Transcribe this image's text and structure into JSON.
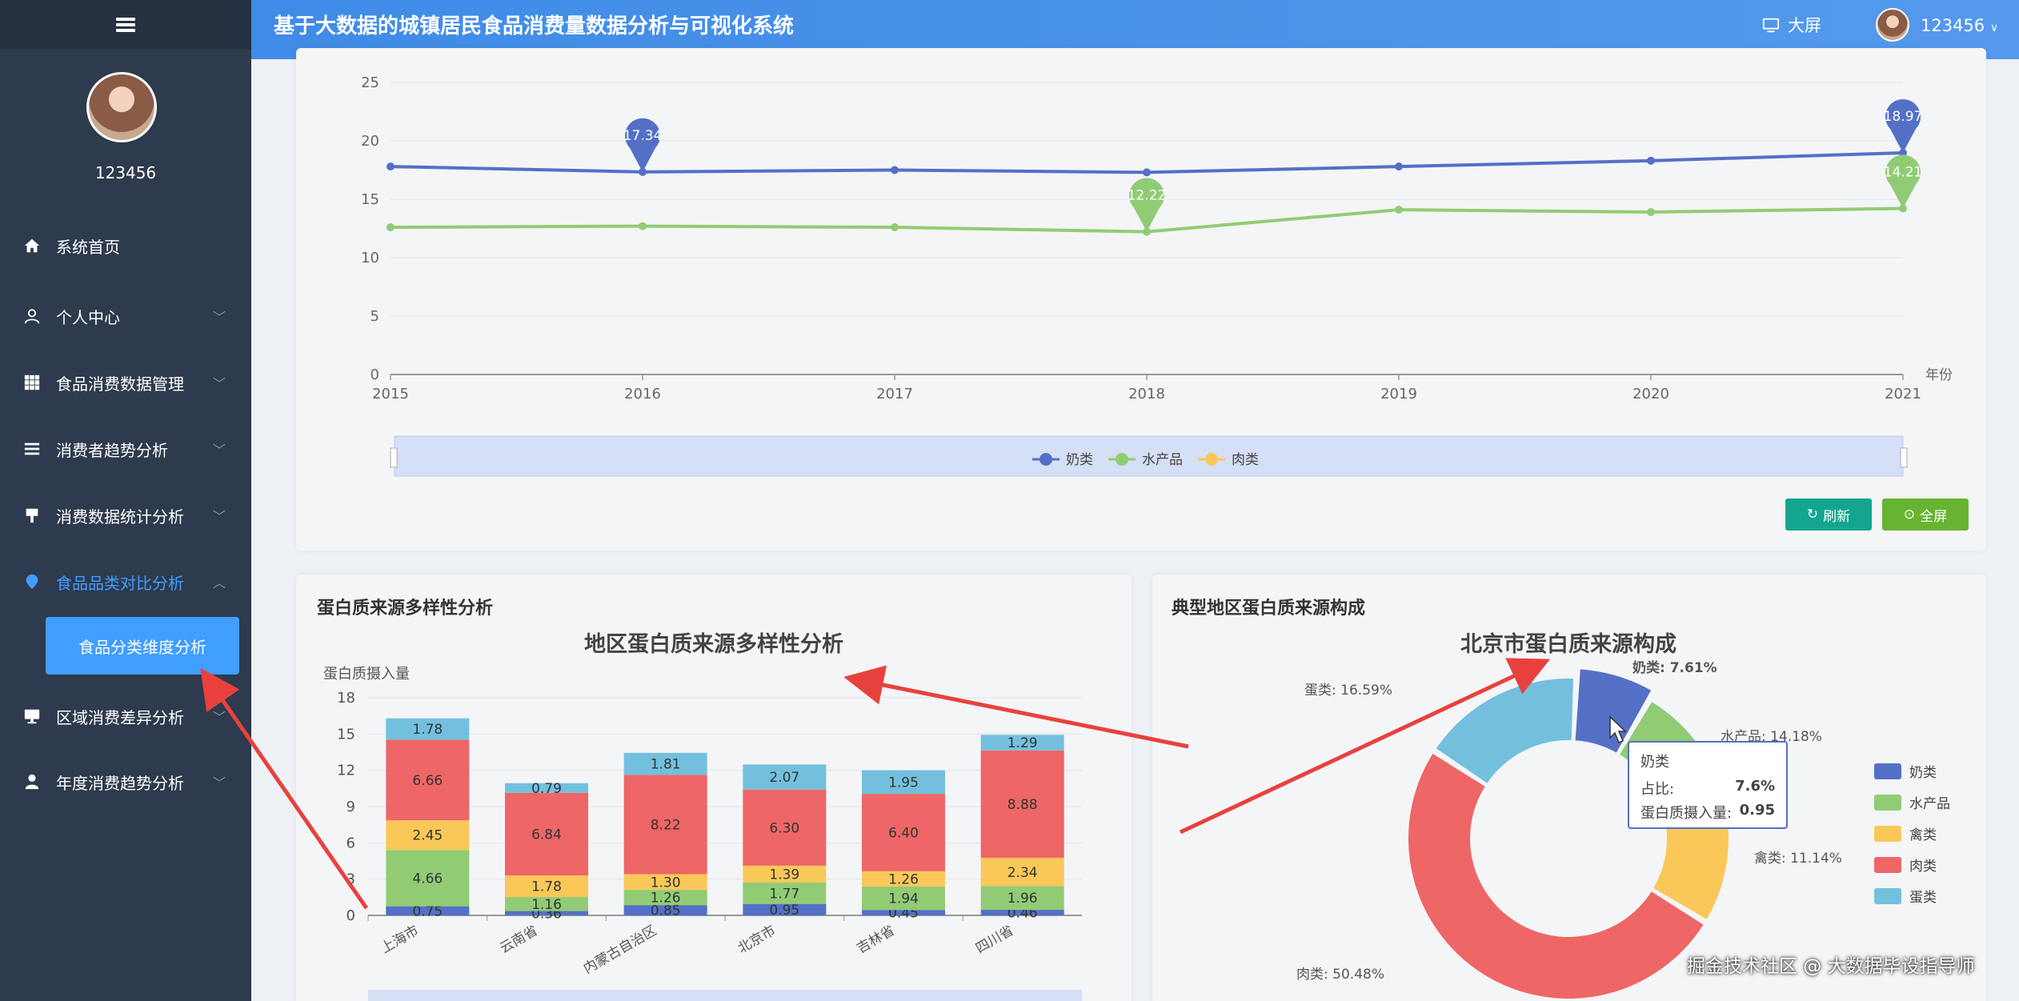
{
  "app": {
    "title": "基于大数据的城镇居民食品消费量数据分析与可视化系统",
    "bigscreen_label": "大屏",
    "username": "123456",
    "dropdown_caret": "∨"
  },
  "sidebar": {
    "username": "123456",
    "items": [
      {
        "label": "系统首页",
        "icon": "home-icon"
      },
      {
        "label": "个人中心",
        "icon": "user-icon"
      },
      {
        "label": "食品消费数据管理",
        "icon": "grid-icon"
      },
      {
        "label": "消费者趋势分析",
        "icon": "list-icon"
      },
      {
        "label": "消费数据统计分析",
        "icon": "tool-icon"
      },
      {
        "label": "食品品类对比分析",
        "icon": "pin-icon"
      },
      {
        "label": "区域消费差异分析",
        "icon": "monitor-icon"
      },
      {
        "label": "年度消费趋势分析",
        "icon": "person-icon"
      }
    ],
    "active_sub": "食品分类维度分析"
  },
  "buttons": {
    "refresh": "刷新",
    "fullscreen": "全屏"
  },
  "line_chart": {
    "chart_data": {
      "type": "line",
      "x": [
        "2015",
        "2016",
        "2017",
        "2018",
        "2019",
        "2020",
        "2021"
      ],
      "xlabel": "年份",
      "ylim": [
        0,
        25
      ],
      "yticks": [
        0,
        5,
        10,
        15,
        20,
        25
      ],
      "series": [
        {
          "name": "奶类",
          "color": "#5470c6",
          "values": [
            17.8,
            17.34,
            17.5,
            17.3,
            17.8,
            18.3,
            18.97
          ]
        },
        {
          "name": "水产品",
          "color": "#91cc75",
          "values": [
            12.6,
            12.7,
            12.6,
            12.22,
            14.1,
            13.9,
            14.21
          ]
        },
        {
          "name": "肉类",
          "color": "#fac858",
          "values": []
        }
      ],
      "markers": [
        {
          "series": "奶类",
          "x": "2016",
          "label": "17.34"
        },
        {
          "series": "奶类",
          "x": "2021",
          "label": "18.97"
        },
        {
          "series": "水产品",
          "x": "2018",
          "label": "12.22"
        },
        {
          "series": "水产品",
          "x": "2021",
          "label": "14.21"
        }
      ],
      "legend": "bottom-center"
    }
  },
  "bar_section": {
    "title": "蛋白质来源多样性分析",
    "chart_data": {
      "type": "bar",
      "title": "地区蛋白质来源多样性分析",
      "ylabel": "蛋白质摄入量",
      "ylim": [
        0,
        18
      ],
      "yticks": [
        0,
        3,
        6,
        9,
        12,
        15,
        18
      ],
      "stacked": true,
      "categories": [
        "上海市",
        "云南省",
        "内蒙古自治区",
        "北京市",
        "吉林省",
        "四川省"
      ],
      "series": [
        {
          "name": "奶类",
          "color": "#5470c6",
          "values": [
            0.75,
            0.36,
            0.85,
            0.95,
            0.45,
            0.46
          ]
        },
        {
          "name": "水产品",
          "color": "#91cc75",
          "values": [
            4.66,
            1.16,
            1.26,
            1.77,
            1.94,
            1.96
          ]
        },
        {
          "name": "禽类",
          "color": "#fac858",
          "values": [
            2.45,
            1.78,
            1.3,
            1.39,
            1.26,
            2.34
          ]
        },
        {
          "name": "肉类",
          "color": "#ee6666",
          "values": [
            6.66,
            6.84,
            8.22,
            6.3,
            6.4,
            8.88
          ]
        },
        {
          "name": "蛋类",
          "color": "#73c0de",
          "values": [
            1.78,
            0.79,
            1.81,
            2.07,
            1.95,
            1.29
          ]
        }
      ]
    }
  },
  "pie_section": {
    "title": "典型地区蛋白质来源构成",
    "chart_data": {
      "type": "pie",
      "title": "北京市蛋白质来源构成",
      "slices": [
        {
          "name": "奶类",
          "value": 7.61,
          "color": "#5470c6",
          "label": "奶类: 7.61%"
        },
        {
          "name": "水产品",
          "value": 14.18,
          "color": "#91cc75",
          "label": "水产品: 14.18%"
        },
        {
          "name": "禽类",
          "value": 11.14,
          "color": "#fac858",
          "label": "禽类: 11.14%"
        },
        {
          "name": "肉类",
          "value": 50.48,
          "color": "#ee6666",
          "label": "肉类: 50.48%"
        },
        {
          "name": "蛋类",
          "value": 16.59,
          "color": "#73c0de",
          "label": "蛋类: 16.59%"
        }
      ],
      "legend": "right"
    },
    "tooltip": {
      "title": "奶类",
      "row1_label": "占比:",
      "row1_value": "7.6%",
      "row2_label": "蛋白质摄入量:",
      "row2_value": "0.95"
    }
  },
  "watermark": "掘金技术社区 @ 大数据毕设指导师"
}
